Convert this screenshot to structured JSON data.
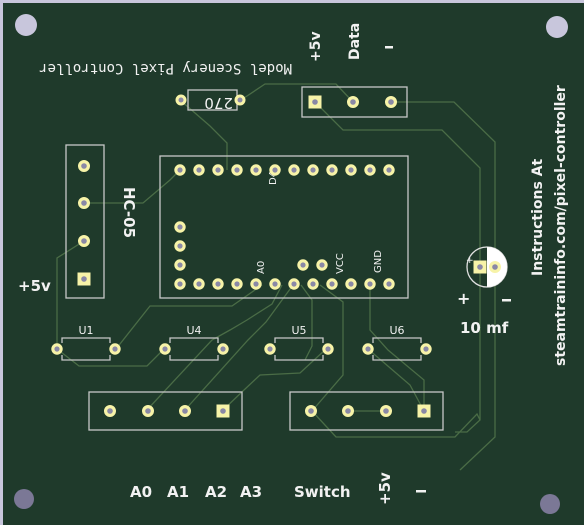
{
  "board": {
    "colors": {
      "background": "#c8c6dc",
      "substrate": "#1f3a2b",
      "silkscreen": "#f2f2f2",
      "pad": "#f7f3a8",
      "drill": "#8a88a6",
      "trace": "#4a6c46"
    },
    "title_mirrored": "Model Scenery Pixel Controller",
    "instructions": {
      "line1": "Instructions At",
      "line2": "steamtraininfo.com/pixel-controller"
    }
  },
  "components": {
    "resistor": {
      "value": "270"
    },
    "header_top": {
      "labels": [
        "+5v",
        "Data",
        "-"
      ]
    },
    "hc05": {
      "ref": "HC-05",
      "power_label": "+5v"
    },
    "arduino": {
      "ref": "D4",
      "pin_labels": {
        "a0": "A0",
        "vcc": "VCC",
        "gnd": "GND"
      }
    },
    "diodes": [
      {
        "ref": "U1"
      },
      {
        "ref": "U4"
      },
      {
        "ref": "U5"
      },
      {
        "ref": "U6"
      }
    ],
    "capacitor": {
      "value": "10 mf",
      "plus": "+",
      "minus": "-"
    },
    "bottom_labels": {
      "a0": "A0",
      "a1": "A1",
      "a2": "A2",
      "a3": "A3",
      "switch": "Switch",
      "plus5v": "+5v",
      "minus": "-"
    }
  }
}
